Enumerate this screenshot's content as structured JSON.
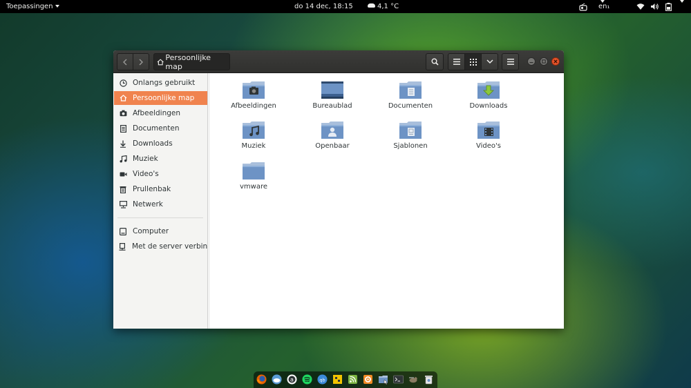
{
  "topbar": {
    "apps_label": "Toepassingen",
    "clock": "do 14 dec, 18:15",
    "weather": "4,1 °C",
    "keyboard": "en₁"
  },
  "window": {
    "path_label": "Persoonlijke map"
  },
  "sidebar": {
    "items": [
      {
        "label": "Onlangs gebruikt",
        "icon": "clock-icon"
      },
      {
        "label": "Persoonlijke map",
        "icon": "home-icon",
        "selected": true
      },
      {
        "label": "Afbeeldingen",
        "icon": "camera-icon"
      },
      {
        "label": "Documenten",
        "icon": "document-icon"
      },
      {
        "label": "Downloads",
        "icon": "download-icon"
      },
      {
        "label": "Muziek",
        "icon": "music-icon"
      },
      {
        "label": "Video's",
        "icon": "video-icon"
      },
      {
        "label": "Prullenbak",
        "icon": "trash-icon"
      },
      {
        "label": "Netwerk",
        "icon": "network-icon"
      },
      {
        "label": "Computer",
        "icon": "computer-icon"
      },
      {
        "label": "Met de server verbin…",
        "icon": "server-icon"
      }
    ]
  },
  "files": [
    {
      "name": "Afbeeldingen",
      "emblem": "camera"
    },
    {
      "name": "Bureaublad",
      "emblem": "desktop"
    },
    {
      "name": "Documenten",
      "emblem": "document"
    },
    {
      "name": "Downloads",
      "emblem": "download"
    },
    {
      "name": "Muziek",
      "emblem": "music"
    },
    {
      "name": "Openbaar",
      "emblem": "person"
    },
    {
      "name": "Sjablonen",
      "emblem": "template"
    },
    {
      "name": "Video's",
      "emblem": "film"
    },
    {
      "name": "vmware",
      "emblem": "none"
    }
  ],
  "colors": {
    "selection": "#f0834e",
    "folder_body": "#6d93c5",
    "close_button": "#e7542a"
  },
  "dock": [
    "firefox-icon",
    "weather-app-icon",
    "software-center-icon",
    "spotify-icon",
    "qbittorrent-icon",
    "puzzle-icon",
    "rss-icon",
    "settings-icon",
    "files-icon",
    "terminal-icon",
    "gimp-icon",
    "trash-dock-icon"
  ]
}
